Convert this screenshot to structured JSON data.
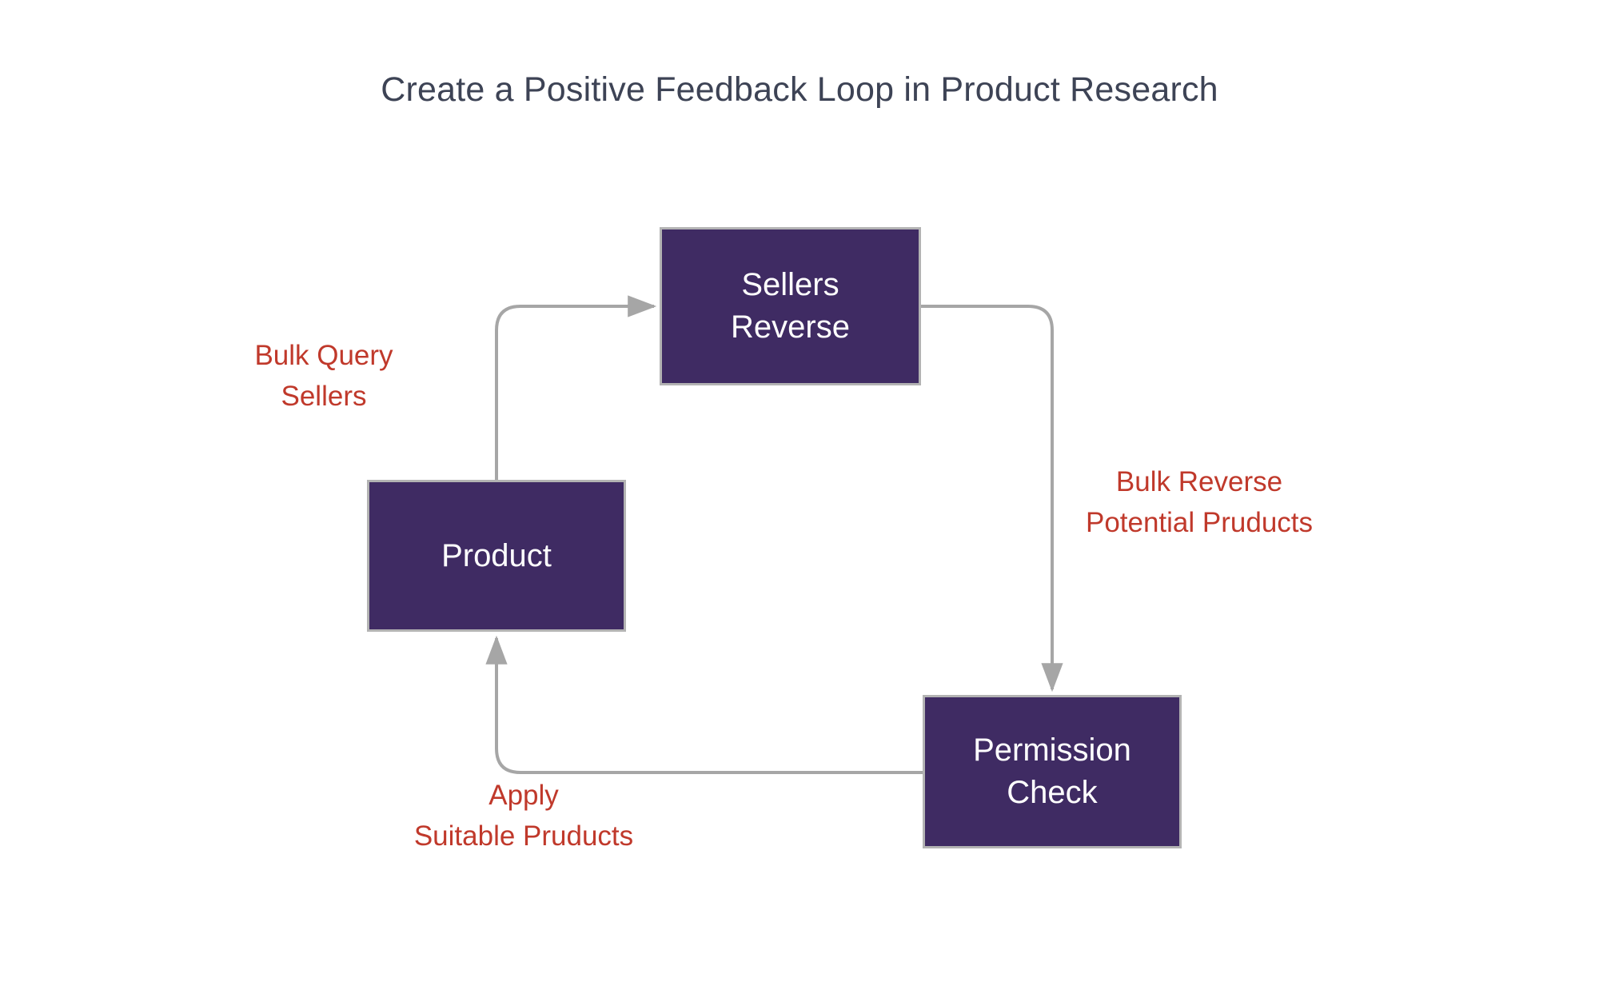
{
  "page": {
    "title": "Create a Positive Feedback Loop in Product Research",
    "background_color": "#ffffff",
    "title_color": "#3d4355"
  },
  "theme": {
    "node_fill": "#3f2b63",
    "node_border": "#b3b3b3",
    "node_text": "#ffffff",
    "edge_color": "#a6a6a6",
    "edge_label_color": "#c0392b"
  },
  "nodes": [
    {
      "id": "sellers-reverse",
      "label_line1": "Sellers",
      "label_line2": "Reverse"
    },
    {
      "id": "product",
      "label_line1": "Product",
      "label_line2": ""
    },
    {
      "id": "permission-check",
      "label_line1": "Permission",
      "label_line2": "Check"
    }
  ],
  "edges": [
    {
      "id": "product-to-sellers",
      "from": "product",
      "to": "sellers-reverse",
      "label_line1": "Bulk Query",
      "label_line2": "Sellers"
    },
    {
      "id": "sellers-to-permission",
      "from": "sellers-reverse",
      "to": "permission-check",
      "label_line1": "Bulk Reverse",
      "label_line2": "Potential Pruducts"
    },
    {
      "id": "permission-to-product",
      "from": "permission-check",
      "to": "product",
      "label_line1": "Apply",
      "label_line2": "Suitable Pruducts"
    }
  ]
}
